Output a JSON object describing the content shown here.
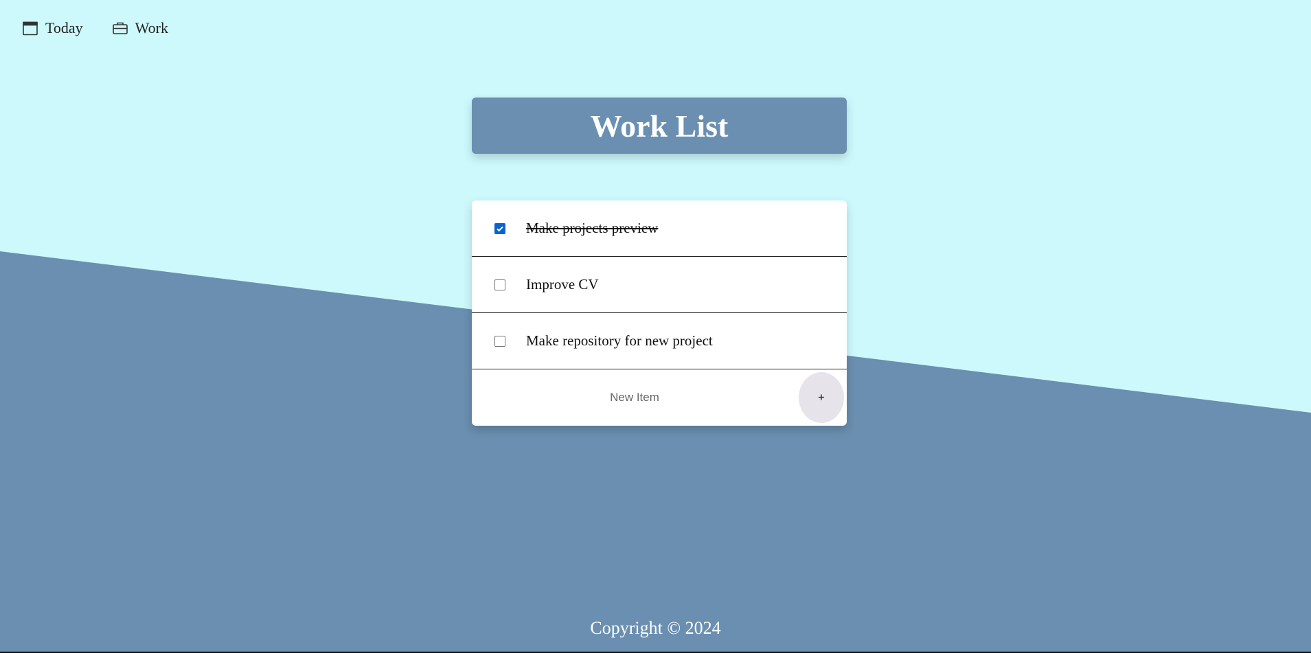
{
  "nav": {
    "items": [
      {
        "label": "Today",
        "icon": "calendar-icon"
      },
      {
        "label": "Work",
        "icon": "briefcase-icon"
      }
    ]
  },
  "list": {
    "title": "Work List",
    "items": [
      {
        "text": "Make projects preview",
        "checked": true
      },
      {
        "text": "Improve CV",
        "checked": false
      },
      {
        "text": "Make repository for new project",
        "checked": false
      }
    ],
    "new_item_placeholder": "New Item",
    "add_button_label": "+"
  },
  "footer": {
    "copyright": "Copyright © 2024"
  },
  "colors": {
    "background_light": "#cdf9fd",
    "background_dark": "#6a8fb0",
    "title_card": "#6a8fb0",
    "checkbox_checked": "#0b63ce",
    "add_button": "#e6e4ea"
  }
}
